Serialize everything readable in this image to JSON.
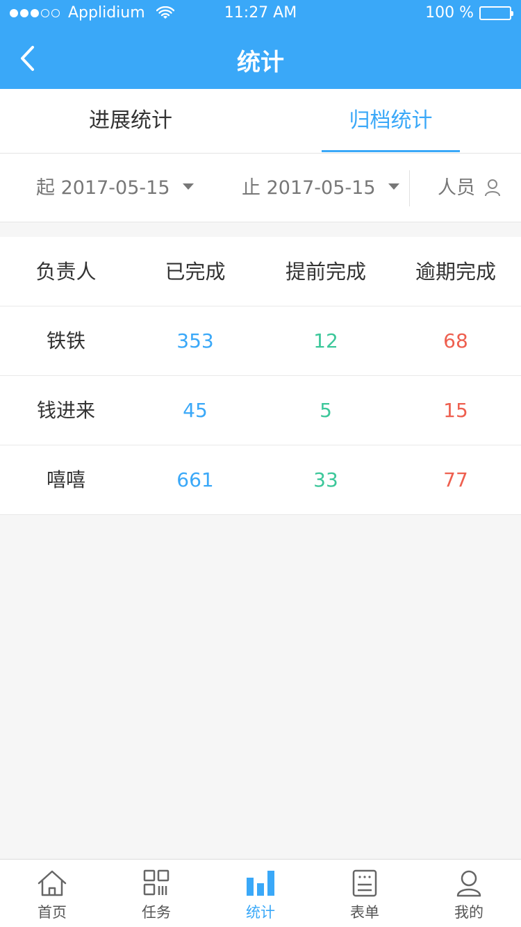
{
  "status_bar": {
    "carrier": "Applidium",
    "time": "11:27 AM",
    "battery": "100 %"
  },
  "nav": {
    "title": "统计",
    "back_icon": "chevron-left-icon"
  },
  "tabs": [
    {
      "label": "进展统计",
      "active": false
    },
    {
      "label": "归档统计",
      "active": true
    }
  ],
  "filter": {
    "start_label": "起",
    "start_date": "2017-05-15",
    "end_label": "止",
    "end_date": "2017-05-15",
    "person_label": "人员"
  },
  "table": {
    "headers": [
      "负责人",
      "已完成",
      "提前完成",
      "逾期完成"
    ],
    "rows": [
      {
        "name": "铁铁",
        "done": "353",
        "early": "12",
        "late": "68"
      },
      {
        "name": "钱进来",
        "done": "45",
        "early": "5",
        "late": "15"
      },
      {
        "name": "嘻嘻",
        "done": "661",
        "early": "33",
        "late": "77"
      }
    ]
  },
  "tabbar": [
    {
      "label": "首页",
      "icon": "home-icon",
      "active": false
    },
    {
      "label": "任务",
      "icon": "task-icon",
      "active": false
    },
    {
      "label": "统计",
      "icon": "bar-chart-icon",
      "active": true
    },
    {
      "label": "表单",
      "icon": "form-icon",
      "active": false
    },
    {
      "label": "我的",
      "icon": "profile-icon",
      "active": false
    }
  ],
  "colors": {
    "primary": "#3aa8f8",
    "done": "#3aa8f8",
    "early": "#3cc79a",
    "late": "#ee5f4f"
  }
}
